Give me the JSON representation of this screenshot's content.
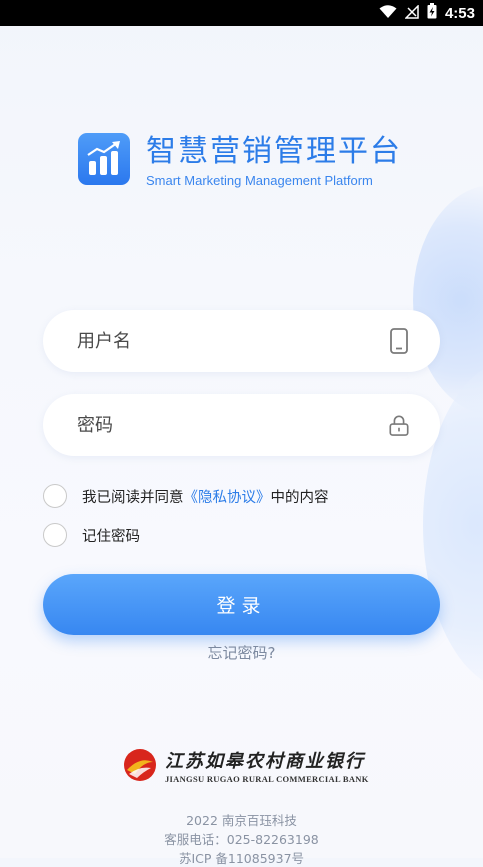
{
  "status_bar": {
    "time": "4:53"
  },
  "app": {
    "title": "智慧营销管理平台",
    "subtitle": "Smart Marketing Management Platform",
    "icon": "bar-chart-trend-icon",
    "accent_color": "#2c7ce8"
  },
  "form": {
    "username_placeholder": "用户名",
    "username_icon": "phone-icon",
    "password_placeholder": "密码",
    "password_icon": "lock-icon",
    "agree_prefix": "我已阅读并同意",
    "agree_link": "《隐私协议》",
    "agree_suffix": "中的内容",
    "remember_label": "记住密码",
    "login_label": "登录",
    "forgot_label": "忘记密码?"
  },
  "bank": {
    "name_cn": "江苏如皋农村商业银行",
    "name_en": "JIANGSU RUGAO RURAL COMMERCIAL BANK"
  },
  "footer": {
    "copyright": "2022 南京百珏科技",
    "hotline": "客服电话：025-82263198",
    "icp": "苏ICP 备11085937号"
  }
}
